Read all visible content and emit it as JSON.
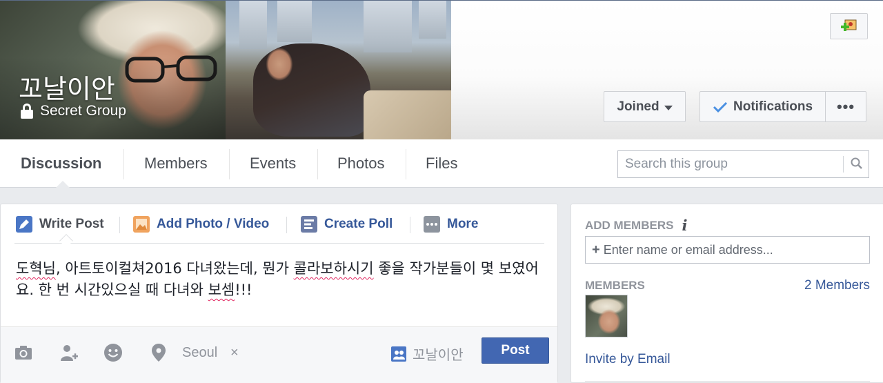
{
  "group": {
    "name": "꼬날이안",
    "privacy": "Secret Group"
  },
  "cover_buttons": {
    "joined": "Joined",
    "notifications": "Notifications",
    "more": "•••"
  },
  "nav": {
    "tabs": [
      {
        "label": "Discussion",
        "active": true
      },
      {
        "label": "Members"
      },
      {
        "label": "Events"
      },
      {
        "label": "Photos"
      },
      {
        "label": "Files"
      }
    ],
    "search_placeholder": "Search this group"
  },
  "composer": {
    "actions": [
      {
        "label": "Write Post",
        "icon": "pencil-icon"
      },
      {
        "label": "Add Photo / Video",
        "icon": "photo-icon"
      },
      {
        "label": "Create Poll",
        "icon": "poll-icon"
      },
      {
        "label": "More",
        "icon": "more-dots-icon"
      }
    ],
    "text_parts": [
      {
        "t": "도혁님",
        "sp": true
      },
      {
        "t": ",  아트토이컬쳐2016 다녀왔는데, 뭔가 "
      },
      {
        "t": "콜라보하시기",
        "sp": true
      },
      {
        "t": " 좋을 작가분들이 몇 보였어요.  한 번 시간있으실 때 다녀와 "
      },
      {
        "t": "보셈",
        "sp": true
      },
      {
        "t": "!!!"
      }
    ],
    "location": "Seoul",
    "location_remove": "×",
    "audience": "꼬날이안",
    "post_button": "Post"
  },
  "sidebar": {
    "add_members_heading": "ADD MEMBERS",
    "info_glyph": "i",
    "add_members_placeholder": "Enter name or email address...",
    "members_heading": "MEMBERS",
    "members_count": "2 Members",
    "invite_link": "Invite by Email"
  },
  "colors": {
    "link": "#365899",
    "post_button": "#4267b2",
    "page_bg": "#e9ebee"
  }
}
